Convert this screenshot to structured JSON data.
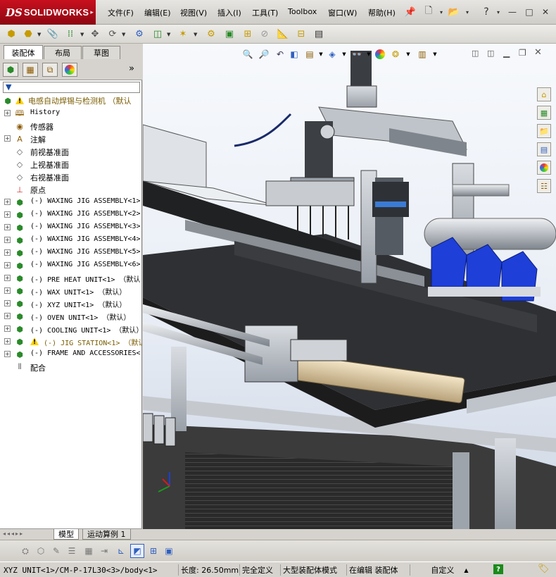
{
  "app": {
    "brand_ds": "DS",
    "brand_name": "SOLIDWORKS"
  },
  "menu": [
    "文件(F)",
    "编辑(E)",
    "视图(V)",
    "插入(I)",
    "工具(T)",
    "Toolbox",
    "窗口(W)",
    "帮助(H)"
  ],
  "window_controls": {
    "help": "?",
    "minimize": "—",
    "restore": "□",
    "close": "✕"
  },
  "manager_tabs": [
    "装配体",
    "布局",
    "草图"
  ],
  "panel_collapse": "»",
  "filter_label": "▼",
  "tree": {
    "root": "电感自动焊锡与检测机 （默认",
    "items": [
      {
        "label": "History",
        "icon": "history-icon",
        "mono": true,
        "expand": true
      },
      {
        "label": "传感器",
        "icon": "sensor-icon",
        "mono": false,
        "expand": false
      },
      {
        "label": "注解",
        "icon": "annotation-icon",
        "mono": false,
        "expand": true
      },
      {
        "label": "前视基准面",
        "icon": "plane-icon",
        "mono": false,
        "expand": false
      },
      {
        "label": "上视基准面",
        "icon": "plane-icon",
        "mono": false,
        "expand": false
      },
      {
        "label": "右视基准面",
        "icon": "plane-icon",
        "mono": false,
        "expand": false
      },
      {
        "label": "原点",
        "icon": "origin-icon",
        "mono": false,
        "expand": false
      },
      {
        "label": "(-) WAXING JIG ASSEMBLY<1>",
        "icon": "assembly-icon",
        "mono": true,
        "expand": true
      },
      {
        "label": "(-) WAXING JIG ASSEMBLY<2>",
        "icon": "assembly-icon",
        "mono": true,
        "expand": true
      },
      {
        "label": "(-) WAXING JIG ASSEMBLY<3>",
        "icon": "assembly-icon",
        "mono": true,
        "expand": true
      },
      {
        "label": "(-) WAXING JIG ASSEMBLY<4>",
        "icon": "assembly-icon",
        "mono": true,
        "expand": true
      },
      {
        "label": "(-) WAXING JIG ASSEMBLY<5>",
        "icon": "assembly-icon",
        "mono": true,
        "expand": true
      },
      {
        "label": "(-) WAXING JIG ASSEMBLY<6>",
        "icon": "assembly-icon",
        "mono": true,
        "expand": true
      },
      {
        "label": "(-) PRE HEAT UNIT<1> （默认",
        "icon": "assembly-icon",
        "mono": true,
        "expand": true
      },
      {
        "label": "(-) WAX UNIT<1> （默认）",
        "icon": "assembly-icon",
        "mono": true,
        "expand": true
      },
      {
        "label": "(-) XYZ UNIT<1> （默认）",
        "icon": "assembly-icon",
        "mono": true,
        "expand": true
      },
      {
        "label": "(-) OVEN UNIT<1> （默认）",
        "icon": "assembly-icon",
        "mono": true,
        "expand": true
      },
      {
        "label": "(-) COOLING UNIT<1> （默认）",
        "icon": "assembly-icon",
        "mono": true,
        "expand": true
      },
      {
        "label": "(-) JIG STATION<1> （默认",
        "icon": "assembly-icon",
        "mono": true,
        "expand": true,
        "warning": true
      },
      {
        "label": "(-) FRAME AND ACCESSORIES<",
        "icon": "assembly-icon",
        "mono": true,
        "expand": true
      },
      {
        "label": "配合",
        "icon": "mates-icon",
        "mono": false,
        "expand": false
      }
    ]
  },
  "bottom_tabs": [
    "模型",
    "运动算例 1"
  ],
  "status": {
    "path": "XYZ UNIT<1>/CM-P-17L30<3>/body<1>",
    "length": "长度: 26.50mm",
    "defined": "完全定义",
    "mode": "大型装配体模式",
    "editing": "在编辑 装配体",
    "custom": "自定义",
    "custom_arrow": "▲",
    "help_badge": "?"
  },
  "colors": {
    "accent": "#c8101e",
    "warn": "#ffd200",
    "blue_part": "#1e3fd8"
  }
}
